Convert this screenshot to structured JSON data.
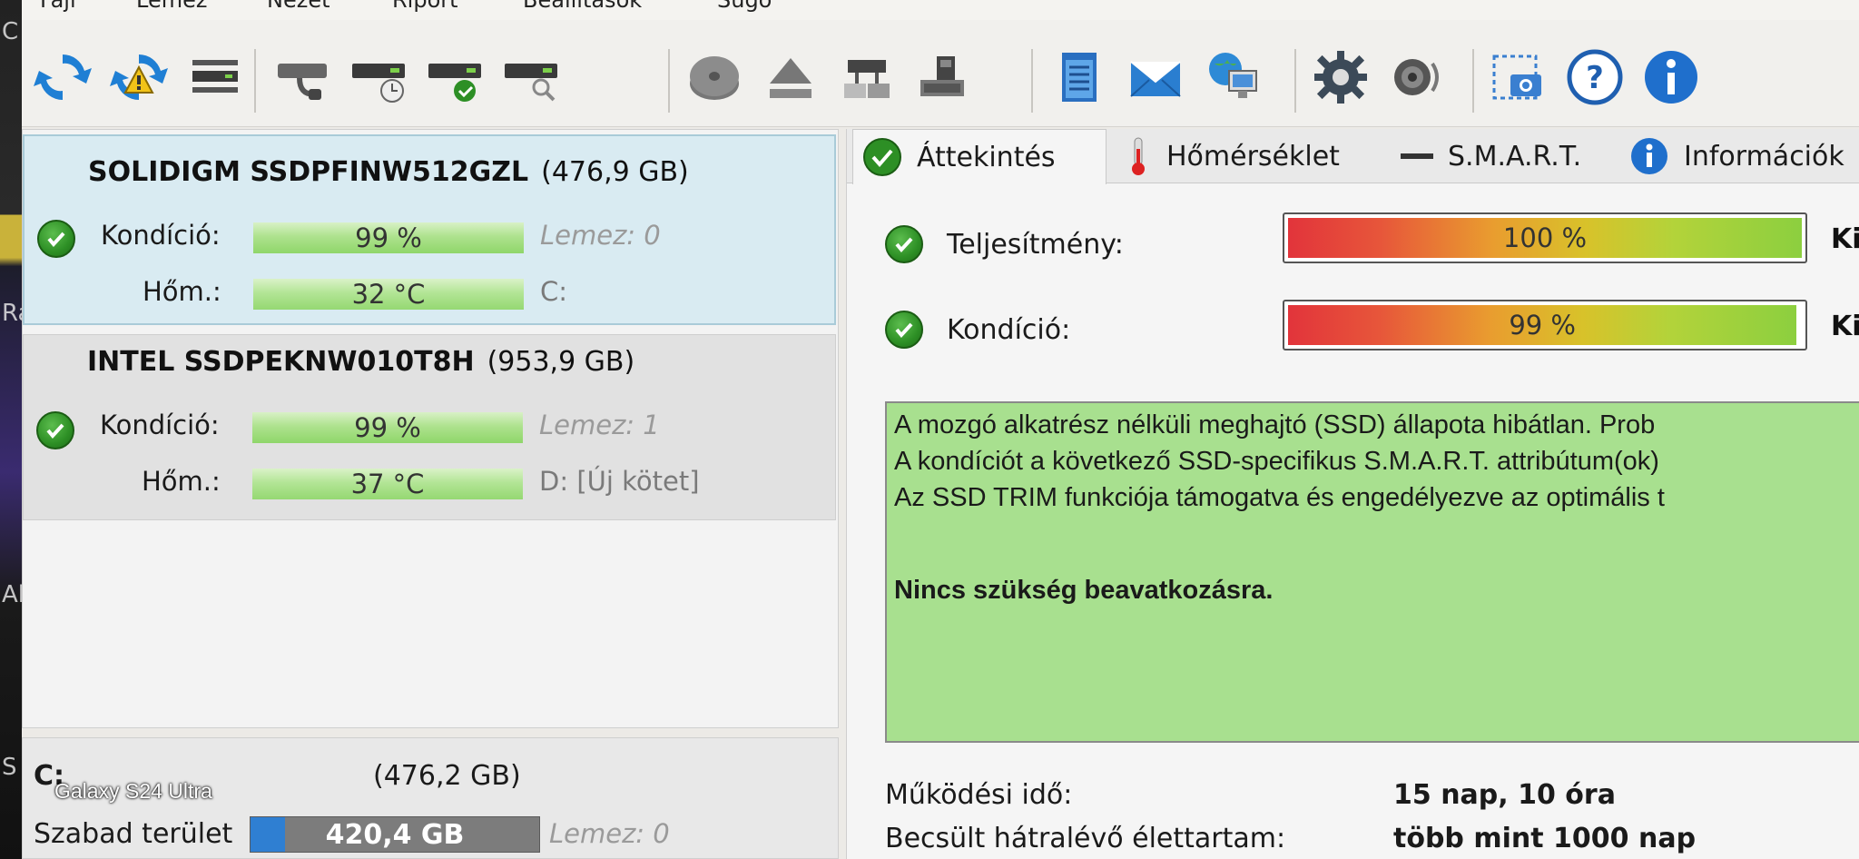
{
  "menu": {
    "items": [
      "Fájl",
      "Lemez",
      "Nézet",
      "Riport",
      "Beállítások",
      "Súgó"
    ]
  },
  "toolbar": {
    "icons": [
      "refresh-icon",
      "refresh-warning-icon",
      "drive-list-icon",
      "drive-power-icon",
      "drive-clock-icon",
      "drive-check-icon",
      "drive-search-icon",
      "disk-platter-icon",
      "eject-icon",
      "drive-network-icon",
      "drive-usb-icon",
      "notepad-icon",
      "email-icon",
      "globe-computer-icon",
      "settings-icon",
      "speaker-icon",
      "screenshot-icon",
      "help-icon",
      "info-icon"
    ]
  },
  "disks": [
    {
      "name": "SOLIDIGM SSDPFINW512GZL",
      "capacity": "(476,9 GB)",
      "condition_label": "Kondíció:",
      "condition_value": "99 %",
      "temp_label": "Hőm.:",
      "temp_value": "32 °C",
      "disk_index": "Lemez: 0",
      "volume": "C:"
    },
    {
      "name": "INTEL SSDPEKNW010T8H",
      "capacity": "(953,9 GB)",
      "condition_label": "Kondíció:",
      "condition_value": "99 %",
      "temp_label": "Hőm.:",
      "temp_value": "37 °C",
      "disk_index": "Lemez: 1",
      "volume": "D: [Új kötet]"
    }
  ],
  "volume": {
    "letter": "C:",
    "size": "(476,2 GB)",
    "free_label": "Szabad terület",
    "free_value": "420,4 GB",
    "disk_index": "Lemez: 0",
    "used_fraction": 0.12
  },
  "watermark": "Galaxy S24 Ultra",
  "tabs": [
    {
      "label": "Áttekintés"
    },
    {
      "label": "Hőmérséklet"
    },
    {
      "label": "S.M.A.R.T."
    },
    {
      "label": "Információk"
    }
  ],
  "overview": {
    "performance_label": "Teljesítmény:",
    "performance_value": "100 %",
    "performance_fraction": 1.0,
    "condition_label": "Kondíció:",
    "condition_value": "99 %",
    "condition_fraction": 0.99,
    "side_cut": "Ki",
    "status_lines": [
      "A mozgó alkatrész nélküli meghajtó (SSD) állapota hibátlan. Prob",
      "A kondíciót a következő SSD-specifikus S.M.A.R.T. attribútum(ok)",
      "Az SSD TRIM funkciója támogatva és engedélyezve az optimális t"
    ],
    "status_summary": "Nincs szükség beavatkozásra.",
    "uptime_label": "Működési idő:",
    "uptime_value": "15 nap, 10 óra",
    "lifetime_label": "Becsült hátralévő élettartam:",
    "lifetime_value": "több mint 1000 nap"
  },
  "colors": {
    "status_green": "#a8e08f",
    "selected_blue": "#d9ebf2",
    "check_green": "#2d8f25"
  }
}
